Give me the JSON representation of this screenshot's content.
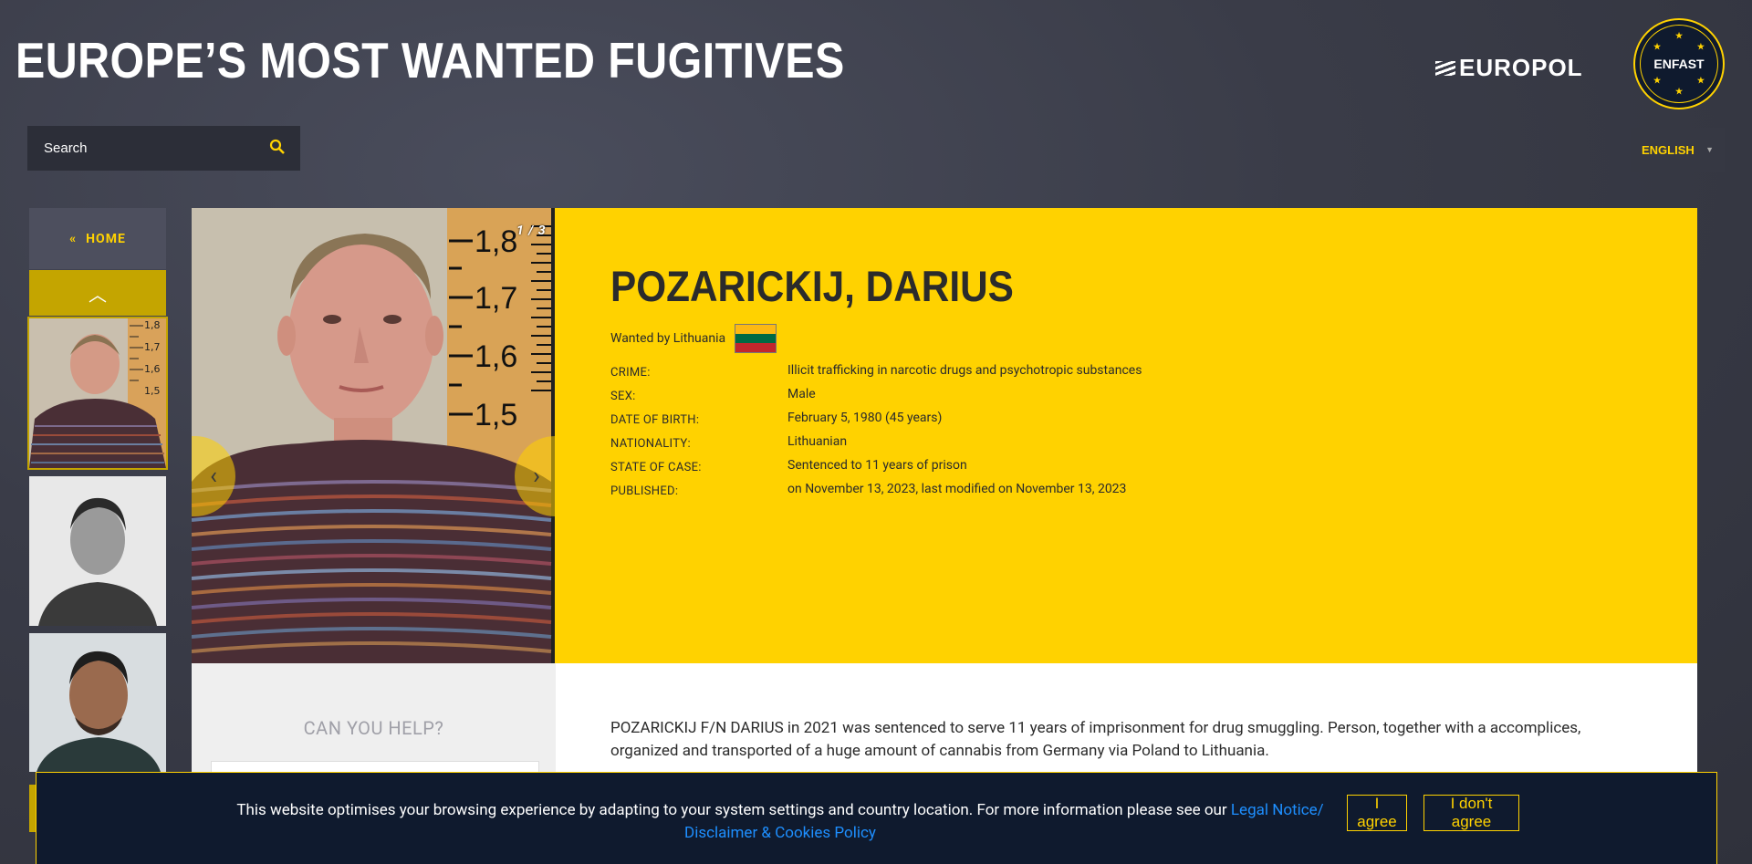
{
  "header": {
    "site_title": "EUROPE’S MOST WANTED FUGITIVES",
    "europol_logo": "EUROPOL",
    "enfast_logo": "ENFAST"
  },
  "search": {
    "placeholder": "Search",
    "icon": "search-icon"
  },
  "language": {
    "selected": "ENGLISH"
  },
  "sidebar": {
    "home_label": "HOME",
    "home_icon": "double-chevron-left-icon",
    "scroll_up_icon": "chevron-up-icon"
  },
  "profile": {
    "photo_counter": "1 / 3",
    "name": "POZARICKIJ, DARIUS",
    "wanted_by": "Wanted by Lithuania",
    "flag_colors": [
      "#FDB913",
      "#006A44",
      "#C1272D"
    ],
    "details": [
      {
        "label": "CRIME:",
        "value": "Illicit trafficking in narcotic drugs and psychotropic substances"
      },
      {
        "label": "SEX:",
        "value": "Male"
      },
      {
        "label": "DATE OF BIRTH:",
        "value": "February 5, 1980 (45 years)"
      },
      {
        "label": "NATIONALITY:",
        "value": "Lithuanian"
      },
      {
        "label": "STATE OF CASE:",
        "value": "Sentenced to 11 years of prison"
      },
      {
        "label": "PUBLISHED:",
        "value": "on November 13, 2023, last modified on November 13, 2023"
      }
    ],
    "prev_arrow": "‹",
    "next_arrow": "›",
    "scale_marks": [
      "1,8",
      "1,7",
      "1,6",
      "1,5"
    ]
  },
  "help": {
    "title": "CAN YOU HELP?"
  },
  "description": "POZARICKIJ F/N DARIUS in 2021 was sentenced to serve 11 years of imprisonment for drug smuggling. Person, together with a accomplices, organized and transported of a huge amount of cannabis from Germany via Poland to Lithuania.",
  "cookie": {
    "text": "This website optimises your browsing experience by adapting to your system settings and country location. For more information please see our",
    "link_text": "Legal Notice/ Disclaimer & Cookies Policy",
    "agree": "I agree",
    "disagree": "I don't agree"
  },
  "colors": {
    "accent": "#FFD200",
    "dark": "#0F1A2E"
  }
}
